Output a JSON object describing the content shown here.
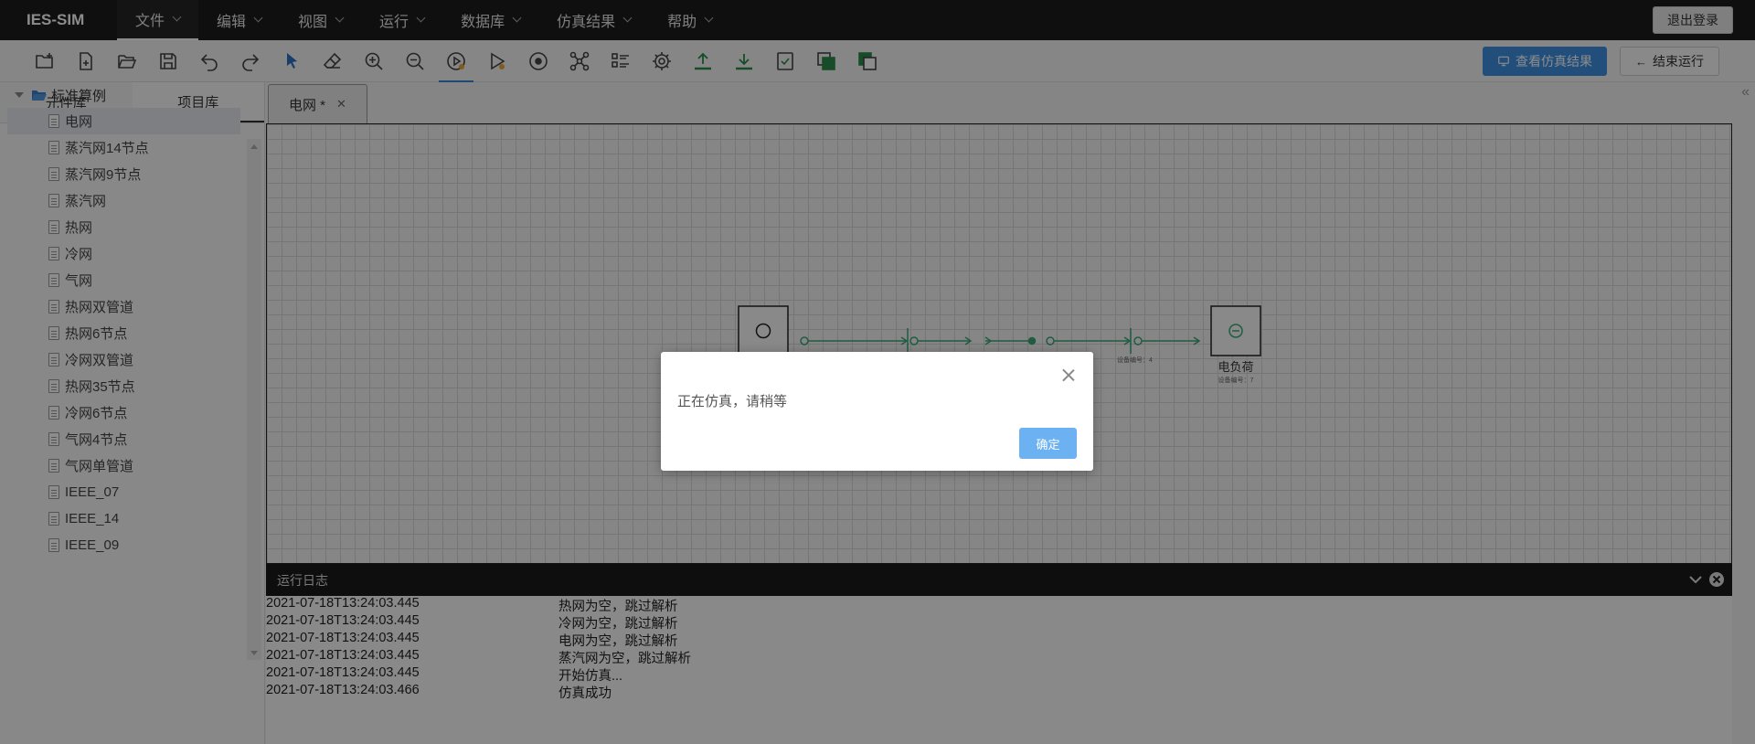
{
  "app": {
    "brand": "IES-SIM",
    "logout_label": "退出登录"
  },
  "menu": [
    {
      "label": "文件"
    },
    {
      "label": "编辑"
    },
    {
      "label": "视图"
    },
    {
      "label": "运行"
    },
    {
      "label": "数据库"
    },
    {
      "label": "仿真结果"
    },
    {
      "label": "帮助"
    }
  ],
  "toolbar": {
    "icons": [
      "new-project-icon",
      "new-file-icon",
      "open-folder-icon",
      "save-icon",
      "undo-icon",
      "redo-icon",
      "select-pointer-icon",
      "eraser-icon",
      "zoom-in-icon",
      "zoom-out-icon",
      "run-simulation-icon",
      "step-run-icon",
      "target-icon",
      "network-icon",
      "checklist-icon",
      "settings-gear-icon",
      "upload-icon",
      "download-icon",
      "verify-icon",
      "copy-icon",
      "layers-icon"
    ],
    "view_results_label": "查看仿真结果",
    "end_run_label": "结束运行"
  },
  "left_panel": {
    "tabs": [
      {
        "label": "元件库"
      },
      {
        "label": "项目库"
      }
    ],
    "tree": {
      "root_label": "标准算例",
      "items": [
        {
          "label": "电网"
        },
        {
          "label": "蒸汽网14节点"
        },
        {
          "label": "蒸汽网9节点"
        },
        {
          "label": "蒸汽网"
        },
        {
          "label": "热网"
        },
        {
          "label": "冷网"
        },
        {
          "label": "气网"
        },
        {
          "label": "热网双管道"
        },
        {
          "label": "热网6节点"
        },
        {
          "label": "冷网双管道"
        },
        {
          "label": "热网35节点"
        },
        {
          "label": "冷网6节点"
        },
        {
          "label": "气网4节点"
        },
        {
          "label": "气网单管道"
        },
        {
          "label": "IEEE_07"
        },
        {
          "label": "IEEE_14"
        },
        {
          "label": "IEEE_09"
        }
      ]
    }
  },
  "editor": {
    "tab_label": "电网 *",
    "diagram": {
      "load_label": "电负荷",
      "load_sublabel": "设备编号：7",
      "bus_sublabel": "设备编号：4"
    }
  },
  "log": {
    "title": "运行日志",
    "rows": [
      {
        "time": "2021-07-18T13:24:03.445",
        "msg": "热网为空，跳过解析"
      },
      {
        "time": "2021-07-18T13:24:03.445",
        "msg": "冷网为空，跳过解析"
      },
      {
        "time": "2021-07-18T13:24:03.445",
        "msg": "电网为空，跳过解析"
      },
      {
        "time": "2021-07-18T13:24:03.445",
        "msg": "蒸汽网为空，跳过解析"
      },
      {
        "time": "2021-07-18T13:24:03.445",
        "msg": "开始仿真..."
      },
      {
        "time": "2021-07-18T13:24:03.466",
        "msg": "仿真成功"
      }
    ]
  },
  "modal": {
    "message": "正在仿真，请稍等",
    "ok_label": "确定"
  },
  "colors": {
    "menubar": "#1d1d1d",
    "primary": "#3c8ee0",
    "diagram_line": "#3aa878",
    "modal_ok": "#6cb2f3"
  }
}
